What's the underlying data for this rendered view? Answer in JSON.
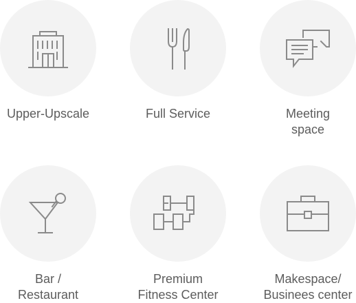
{
  "features": [
    {
      "icon": "building-icon",
      "label": "Upper-Upscale"
    },
    {
      "icon": "fork-knife-icon",
      "label": "Full Service"
    },
    {
      "icon": "chat-bubbles-icon",
      "label": "Meeting\nspace"
    },
    {
      "icon": "cocktail-glass-icon",
      "label": "Bar /\nRestaurant"
    },
    {
      "icon": "dumbbell-icon",
      "label": "Premium\nFitness Center"
    },
    {
      "icon": "briefcase-icon",
      "label": "Makespace/\nBusinees center"
    }
  ]
}
